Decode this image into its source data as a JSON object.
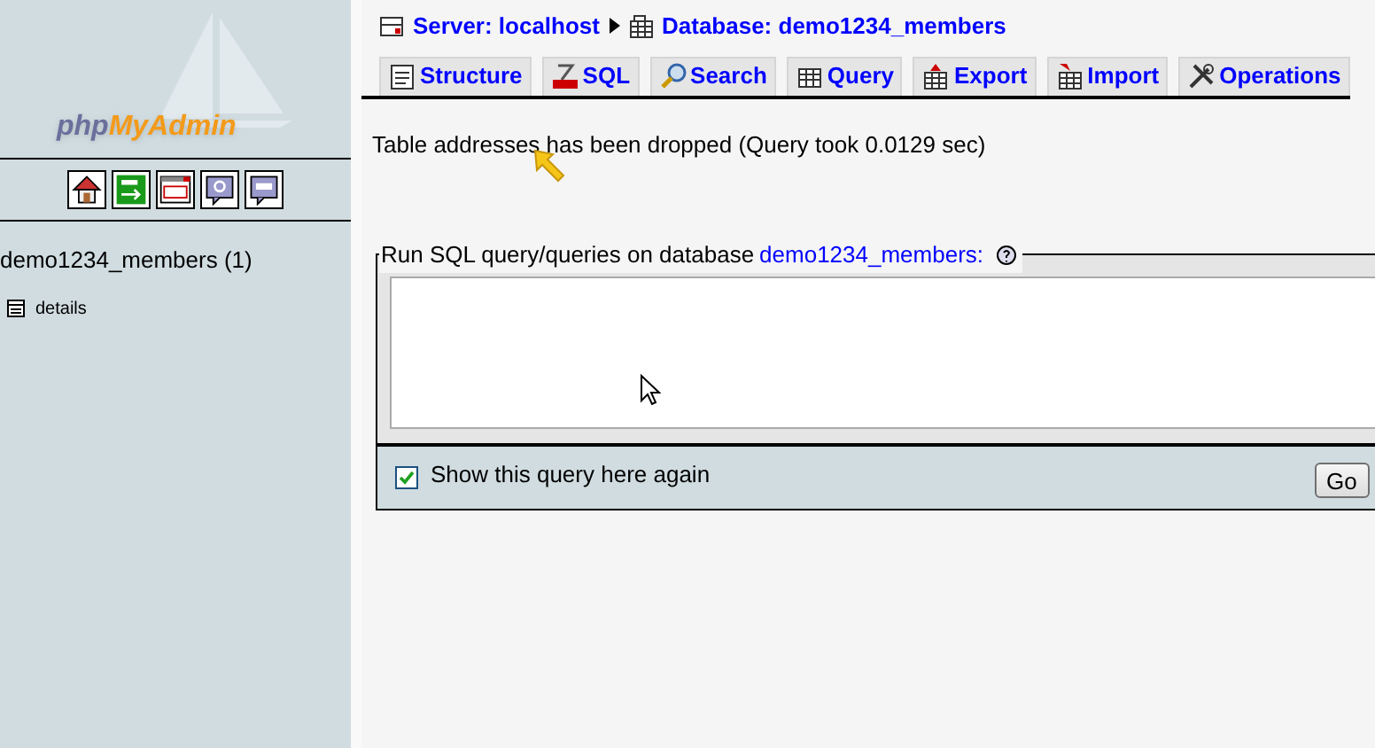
{
  "sidebar": {
    "logo": {
      "prefix": "php",
      "name": "MyAdmin"
    },
    "toolbar": [
      {
        "kind": "home"
      },
      {
        "kind": "exit"
      },
      {
        "kind": "sql-window"
      },
      {
        "kind": "help"
      },
      {
        "kind": "sql-doc"
      }
    ],
    "database": "demo1234_members (1)",
    "tables": [
      {
        "name": "details"
      }
    ]
  },
  "breadcrumb": {
    "server": "Server: localhost",
    "database": "Database: demo1234_members"
  },
  "tabs": [
    {
      "label": "Structure",
      "kind": "structure",
      "selected": false
    },
    {
      "label": "SQL",
      "kind": "sql",
      "selected": false
    },
    {
      "label": "Search",
      "kind": "search",
      "selected": false
    },
    {
      "label": "Query",
      "kind": "query",
      "selected": false
    },
    {
      "label": "Export",
      "kind": "export",
      "selected": false
    },
    {
      "label": "Import",
      "kind": "import",
      "selected": false
    },
    {
      "label": "Operations",
      "kind": "operations",
      "selected": false
    }
  ],
  "message": "Table addresses has been dropped (Query took 0.0129 sec)",
  "query_form": {
    "legend": "Run SQL query/queries on database",
    "database_link": "demo1234_members",
    "legend_suffix": ":",
    "show_again": {
      "label": "Show this query here again",
      "checked": true
    },
    "submit": "Go"
  }
}
